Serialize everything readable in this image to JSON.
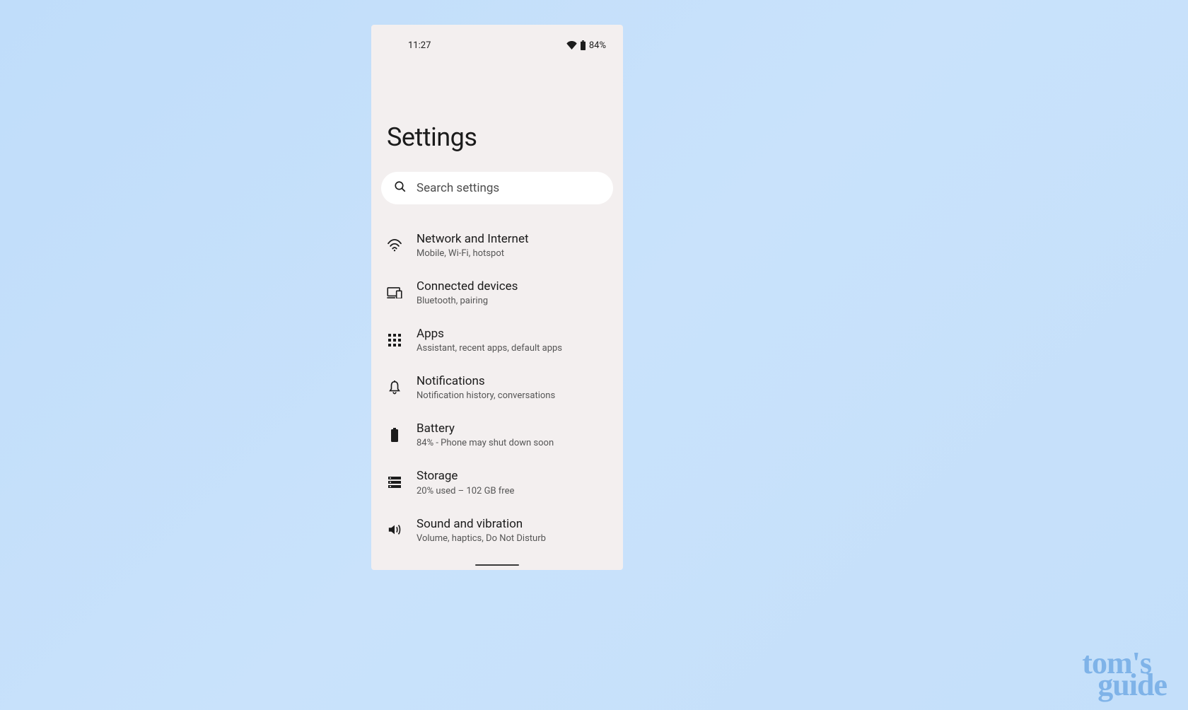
{
  "status": {
    "time": "11:27",
    "battery_percent": "84%"
  },
  "page_title": "Settings",
  "search": {
    "placeholder": "Search settings"
  },
  "items": [
    {
      "icon": "wifi-icon",
      "title": "Network and Internet",
      "sub": "Mobile, Wi-Fi, hotspot"
    },
    {
      "icon": "devices-icon",
      "title": "Connected devices",
      "sub": "Bluetooth, pairing"
    },
    {
      "icon": "apps-icon",
      "title": "Apps",
      "sub": "Assistant, recent apps, default apps"
    },
    {
      "icon": "bell-icon",
      "title": "Notifications",
      "sub": "Notification history, conversations"
    },
    {
      "icon": "battery-icon",
      "title": "Battery",
      "sub": "84% - Phone may shut down soon"
    },
    {
      "icon": "storage-icon",
      "title": "Storage",
      "sub": "20% used – 102 GB free"
    },
    {
      "icon": "sound-icon",
      "title": "Sound and vibration",
      "sub": "Volume, haptics, Do Not Disturb"
    }
  ],
  "watermark": {
    "line1": "tom's",
    "line2": "guide"
  }
}
